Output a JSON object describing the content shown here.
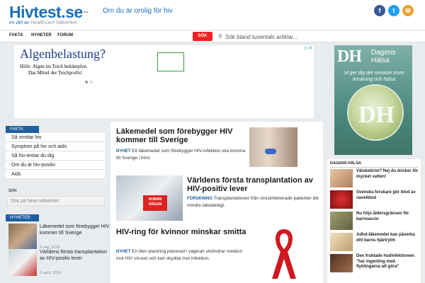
{
  "header": {
    "logo": "Hivtest.se",
    "logo_sub_prefix": "en del av",
    "logo_sub_brand": "Healthcare Nätverket",
    "dash": "–",
    "tagline": "Om du är orolig för hiv",
    "social": [
      "f",
      "t",
      "✉"
    ]
  },
  "nav": {
    "items": [
      "FAKTA",
      "NYHETER",
      "FORUM"
    ],
    "search_button": "SÖK",
    "search_placeholder": "Sök bland tusentals artiklar..."
  },
  "ad": {
    "title": "Algenbelastung?",
    "line1": "Hilfe: Algen im Teich bekämpfen.",
    "line2": "Das Mittel der Teichprofis!"
  },
  "dh_ad": {
    "logo": "DH",
    "name_line1": "Dagens",
    "name_line2": "Hälsa",
    "text": "Vi ger dig det senaste inom forskning och hälsa",
    "big": "DH"
  },
  "sidebar": {
    "fakta_head": "FAKTA",
    "fakta_items": [
      "Så smittar hiv",
      "Symptom på hiv och aids",
      "Så hiv-testar du dig",
      "Om du är hiv-positiv",
      "Aids"
    ],
    "search_label": "SÖK",
    "search_placeholder": "Sök på hela nätverket",
    "nyheter_head": "NYHETER",
    "news": [
      {
        "title": "Läkemedel som förebygger HIV kommer till Sverige",
        "date": "9 maj, 2016"
      },
      {
        "title": "Världens första transplantation av HIV-positiv lever",
        "date": "5 april, 2016"
      }
    ]
  },
  "main": {
    "articles": [
      {
        "title": "Läkemedel som förebygger HIV kommer till Sverige",
        "tag": "NYHET",
        "text": "Ett läkemedel som förebygger HIV-infektion ska komma till Sverige i höst."
      },
      {
        "title": "Världens första transplantation av HIV-positiv lever",
        "tag": "FORSKNING",
        "text": "Transplantationer från virusinfekterade patienter blir mindre tabubelagt.",
        "image_text": "HUMAN ORGAN"
      },
      {
        "title": "HIV-ring för kvinnor minskar smitta",
        "tag": "NYHET",
        "text": "En liten plastring placerad i vaginan utsöndrar medicin mot HIV viruset och kan skydda mot infektion."
      }
    ]
  },
  "dagens_halsa": {
    "head": "DAGENS HÄLSA",
    "items": [
      "Vätskebrist? Nej du dricker för mycket vatten!",
      "Svenska forskare gör blod av navelblod",
      "Nu höjs åldersgränsen för barnvaccin",
      "Adhd-läkemedel kan påverka ditt barns hjärtrytm",
      "Den fruktade hudinfektionen: \"har ingenting med flyktingarna att göra\""
    ]
  }
}
